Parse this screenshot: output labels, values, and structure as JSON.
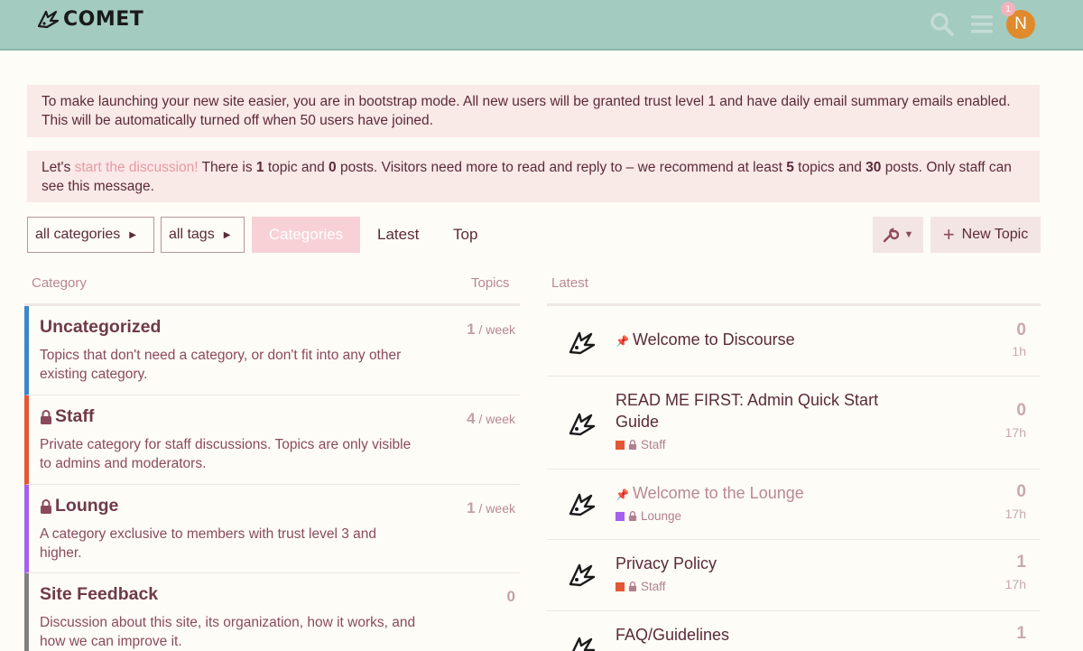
{
  "header": {
    "logo_text": "COMET",
    "notification_count": "1",
    "avatar_letter": "N",
    "icons": [
      "search-icon",
      "hamburger-menu-icon"
    ]
  },
  "notices": {
    "bootstrap": "To make launching your new site easier, you are in bootstrap mode. All new users will be granted trust level 1 and have daily email summary emails enabled. This will be automatically turned off when 50 users have joined.",
    "discussion_prefix": "Let's ",
    "discussion_link": "start the discussion!",
    "discussion_text_1": " There is ",
    "discussion_topics": "1",
    "discussion_text_2": " topic and ",
    "discussion_posts": "0",
    "discussion_text_3": " posts. Visitors need more to read and reply to – we recommend at least ",
    "discussion_rec_topics": "5",
    "discussion_text_4": " topics and ",
    "discussion_rec_posts": "30",
    "discussion_text_5": " posts. Only staff can see this message."
  },
  "nav": {
    "categories_dropdown": "all categories",
    "tags_dropdown": "all tags",
    "tab_categories": "Categories",
    "tab_latest": "Latest",
    "tab_top": "Top",
    "new_topic": "New Topic"
  },
  "columns": {
    "category": "Category",
    "topics": "Topics",
    "latest": "Latest"
  },
  "categories": [
    {
      "name": "Uncategorized",
      "description": "Topics that don't need a category, or don't fit into any other existing category.",
      "topics": "1",
      "per": " / week",
      "color": "#3a87c8",
      "locked": false
    },
    {
      "name": "Staff",
      "description": "Private category for staff discussions. Topics are only visible to admins and moderators.",
      "topics": "4",
      "per": " / week",
      "color": "#e45735",
      "locked": true
    },
    {
      "name": "Lounge",
      "description": "A category exclusive to members with trust level 3 and higher.",
      "topics": "1",
      "per": " / week",
      "color": "#a461ef",
      "locked": true
    },
    {
      "name": "Site Feedback",
      "description": "Discussion about this site, its organization, how it works, and how we can improve it.",
      "topics": "0",
      "per": "",
      "color": "#808281",
      "locked": false
    }
  ],
  "latest_topics": [
    {
      "title": "Welcome to Discourse",
      "pinned": true,
      "category": "",
      "replies": "0",
      "age": "1h"
    },
    {
      "title": "READ ME FIRST: Admin Quick Start Guide",
      "pinned": false,
      "category": "Staff",
      "replies": "0",
      "age": "17h"
    },
    {
      "title": "Welcome to the Lounge",
      "pinned": true,
      "category": "Lounge",
      "replies": "0",
      "age": "17h"
    },
    {
      "title": "Privacy Policy",
      "pinned": false,
      "category": "Staff",
      "replies": "1",
      "age": "17h"
    },
    {
      "title": "FAQ/Guidelines",
      "pinned": false,
      "category": "",
      "replies": "1",
      "age": ""
    }
  ]
}
